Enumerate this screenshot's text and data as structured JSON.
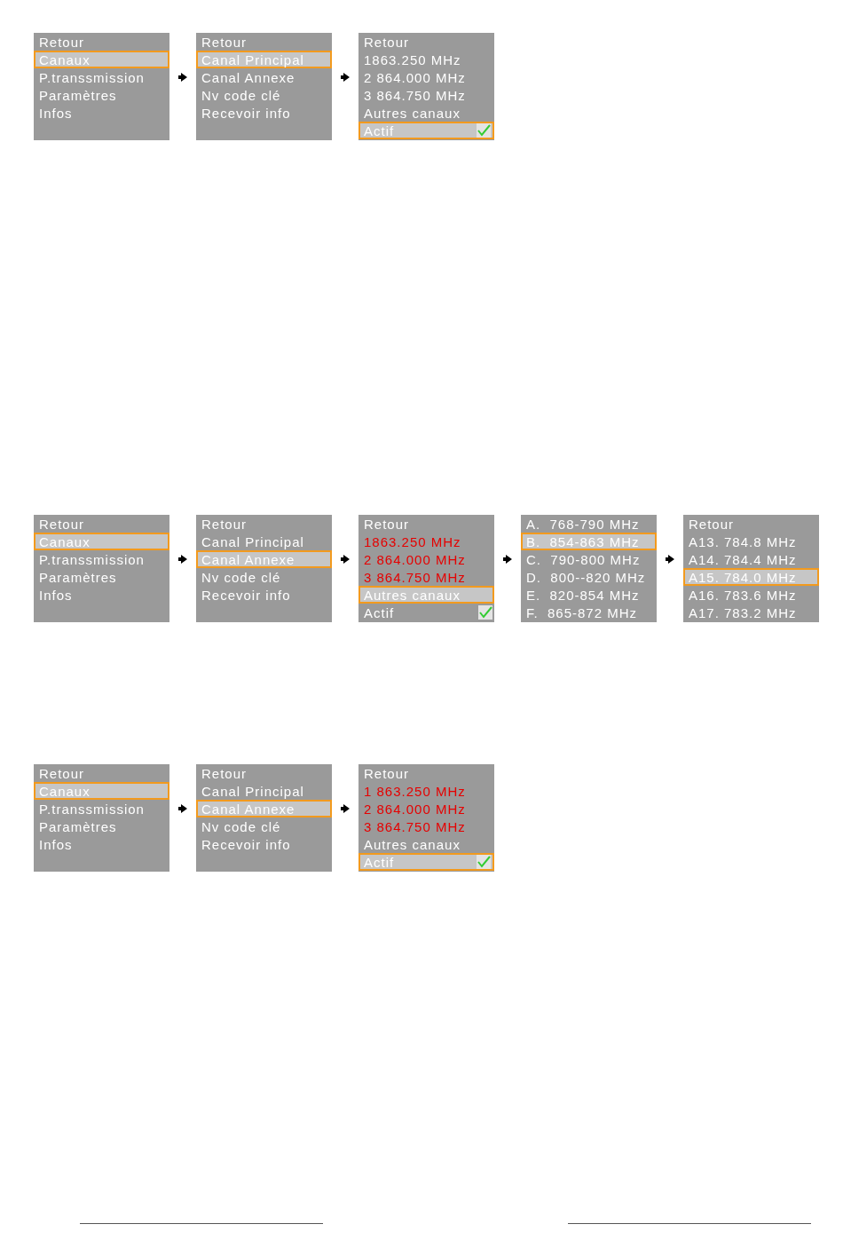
{
  "diagrams": [
    {
      "panels": [
        {
          "items": [
            {
              "label": "Retour",
              "selected": false
            },
            {
              "label": "Canaux",
              "selected": true
            },
            {
              "label": "P.transsmission",
              "selected": false
            },
            {
              "label": "Paramètres",
              "selected": false
            },
            {
              "label": "Infos",
              "selected": false
            }
          ]
        },
        {
          "items": [
            {
              "label": "Retour",
              "selected": false
            },
            {
              "label": "Canal Principal",
              "selected": true
            },
            {
              "label": "Canal Annexe",
              "selected": false
            },
            {
              "label": "Nv code clé",
              "selected": false
            },
            {
              "label": "Recevoir info",
              "selected": false
            }
          ]
        },
        {
          "items": [
            {
              "label": "Retour",
              "selected": false,
              "kind": "entry"
            },
            {
              "label": "1863.250 MHz",
              "selected": false,
              "kind": "entry"
            },
            {
              "label": "2 864.000 MHz",
              "selected": false,
              "kind": "entry"
            },
            {
              "label": "3 864.750 MHz",
              "selected": false,
              "kind": "entry"
            },
            {
              "label": "Autres canaux",
              "selected": false,
              "kind": "entry"
            },
            {
              "label": "Actif",
              "selected": true,
              "kind": "checkbox",
              "checked": true
            }
          ]
        }
      ]
    },
    {
      "panels": [
        {
          "items": [
            {
              "label": "Retour",
              "selected": false
            },
            {
              "label": "Canaux",
              "selected": true
            },
            {
              "label": "P.transsmission",
              "selected": false
            },
            {
              "label": "Paramètres",
              "selected": false
            },
            {
              "label": "Infos",
              "selected": false
            }
          ]
        },
        {
          "items": [
            {
              "label": "Retour",
              "selected": false
            },
            {
              "label": "Canal Principal",
              "selected": false
            },
            {
              "label": "Canal Annexe",
              "selected": true
            },
            {
              "label": "Nv code clé",
              "selected": false
            },
            {
              "label": "Recevoir info",
              "selected": false
            }
          ]
        },
        {
          "items": [
            {
              "label": "Retour",
              "selected": false,
              "kind": "entry",
              "emphasized": false
            },
            {
              "label": "1863.250 MHz",
              "selected": false,
              "kind": "entry",
              "emphasized": true
            },
            {
              "label": "2 864.000 MHz",
              "selected": false,
              "kind": "entry",
              "emphasized": true
            },
            {
              "label": "3 864.750 MHz",
              "selected": false,
              "kind": "entry",
              "emphasized": true
            },
            {
              "label": "Autres canaux",
              "selected": true,
              "kind": "entry",
              "emphasized": false
            },
            {
              "label": "Actif",
              "selected": false,
              "kind": "checkbox",
              "checked": true,
              "emphasized": false
            }
          ]
        },
        {
          "items": [
            {
              "label": "A.  768-790 MHz",
              "selected": false
            },
            {
              "label": "B.  854-863 MHz",
              "selected": true
            },
            {
              "label": "C.  790-800 MHz",
              "selected": false
            },
            {
              "label": "D.  800--820 MHz",
              "selected": false
            },
            {
              "label": "E.  820-854 MHz",
              "selected": false
            },
            {
              "label": "F.  865-872 MHz",
              "selected": false
            }
          ]
        },
        {
          "items": [
            {
              "label": "Retour",
              "selected": false
            },
            {
              "label": "A13. 784.8 MHz",
              "selected": false
            },
            {
              "label": "A14. 784.4 MHz",
              "selected": false
            },
            {
              "label": "A15. 784.0 MHz",
              "selected": true
            },
            {
              "label": "A16. 783.6 MHz",
              "selected": false
            },
            {
              "label": "A17. 783.2 MHz",
              "selected": false
            }
          ]
        }
      ]
    },
    {
      "panels": [
        {
          "items": [
            {
              "label": "Retour",
              "selected": false
            },
            {
              "label": "Canaux",
              "selected": true
            },
            {
              "label": "P.transsmission",
              "selected": false
            },
            {
              "label": "Paramètres",
              "selected": false
            },
            {
              "label": "Infos",
              "selected": false
            }
          ]
        },
        {
          "items": [
            {
              "label": "Retour",
              "selected": false
            },
            {
              "label": "Canal Principal",
              "selected": false
            },
            {
              "label": "Canal Annexe",
              "selected": true
            },
            {
              "label": "Nv code clé",
              "selected": false
            },
            {
              "label": "Recevoir info",
              "selected": false
            }
          ]
        },
        {
          "items": [
            {
              "label": "Retour",
              "selected": false,
              "kind": "entry",
              "emphasized": false
            },
            {
              "label": "1 863.250 MHz",
              "selected": false,
              "kind": "entry",
              "emphasized": true
            },
            {
              "label": "2 864.000 MHz",
              "selected": false,
              "kind": "entry",
              "emphasized": true
            },
            {
              "label": "3 864.750 MHz",
              "selected": false,
              "kind": "entry",
              "emphasized": true
            },
            {
              "label": "Autres canaux",
              "selected": false,
              "kind": "entry",
              "emphasized": false
            },
            {
              "label": "Actif",
              "selected": true,
              "kind": "checkbox",
              "checked": true,
              "emphasized": false
            }
          ]
        }
      ]
    }
  ]
}
